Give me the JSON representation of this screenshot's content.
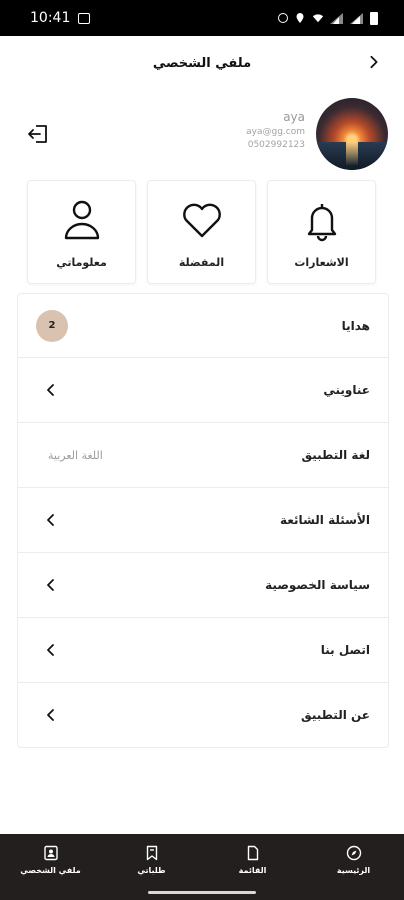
{
  "status_bar": {
    "time": "10:41"
  },
  "header": {
    "title": "ملفي الشخصي"
  },
  "profile": {
    "name": "aya",
    "email": "aya@gg.com",
    "phone": "0502992123"
  },
  "cards": [
    {
      "label": "الاشعارات",
      "icon": "bell-icon"
    },
    {
      "label": "المفضلة",
      "icon": "heart-icon"
    },
    {
      "label": "معلوماتي",
      "icon": "user-icon"
    }
  ],
  "list": {
    "gifts": {
      "label": "هدايا",
      "badge": "2"
    },
    "addresses": {
      "label": "عناويني"
    },
    "language": {
      "label": "لغة التطبيق",
      "value": "اللغة العربية"
    },
    "faq": {
      "label": "الأسئلة الشائعة"
    },
    "privacy": {
      "label": "سياسة الخصوصية"
    },
    "contact": {
      "label": "اتصل بنا"
    },
    "about": {
      "label": "عن التطبيق"
    }
  },
  "bottom_nav": [
    {
      "label": "الرئيسية",
      "icon": "compass-icon"
    },
    {
      "label": "القائمة",
      "icon": "menu-doc-icon"
    },
    {
      "label": "طلباتي",
      "icon": "bookmark-icon"
    },
    {
      "label": "ملفي الشخصي",
      "icon": "profile-icon"
    }
  ],
  "colors": {
    "badge_bg": "#d9c2b0",
    "nav_bg": "#231f1f"
  }
}
